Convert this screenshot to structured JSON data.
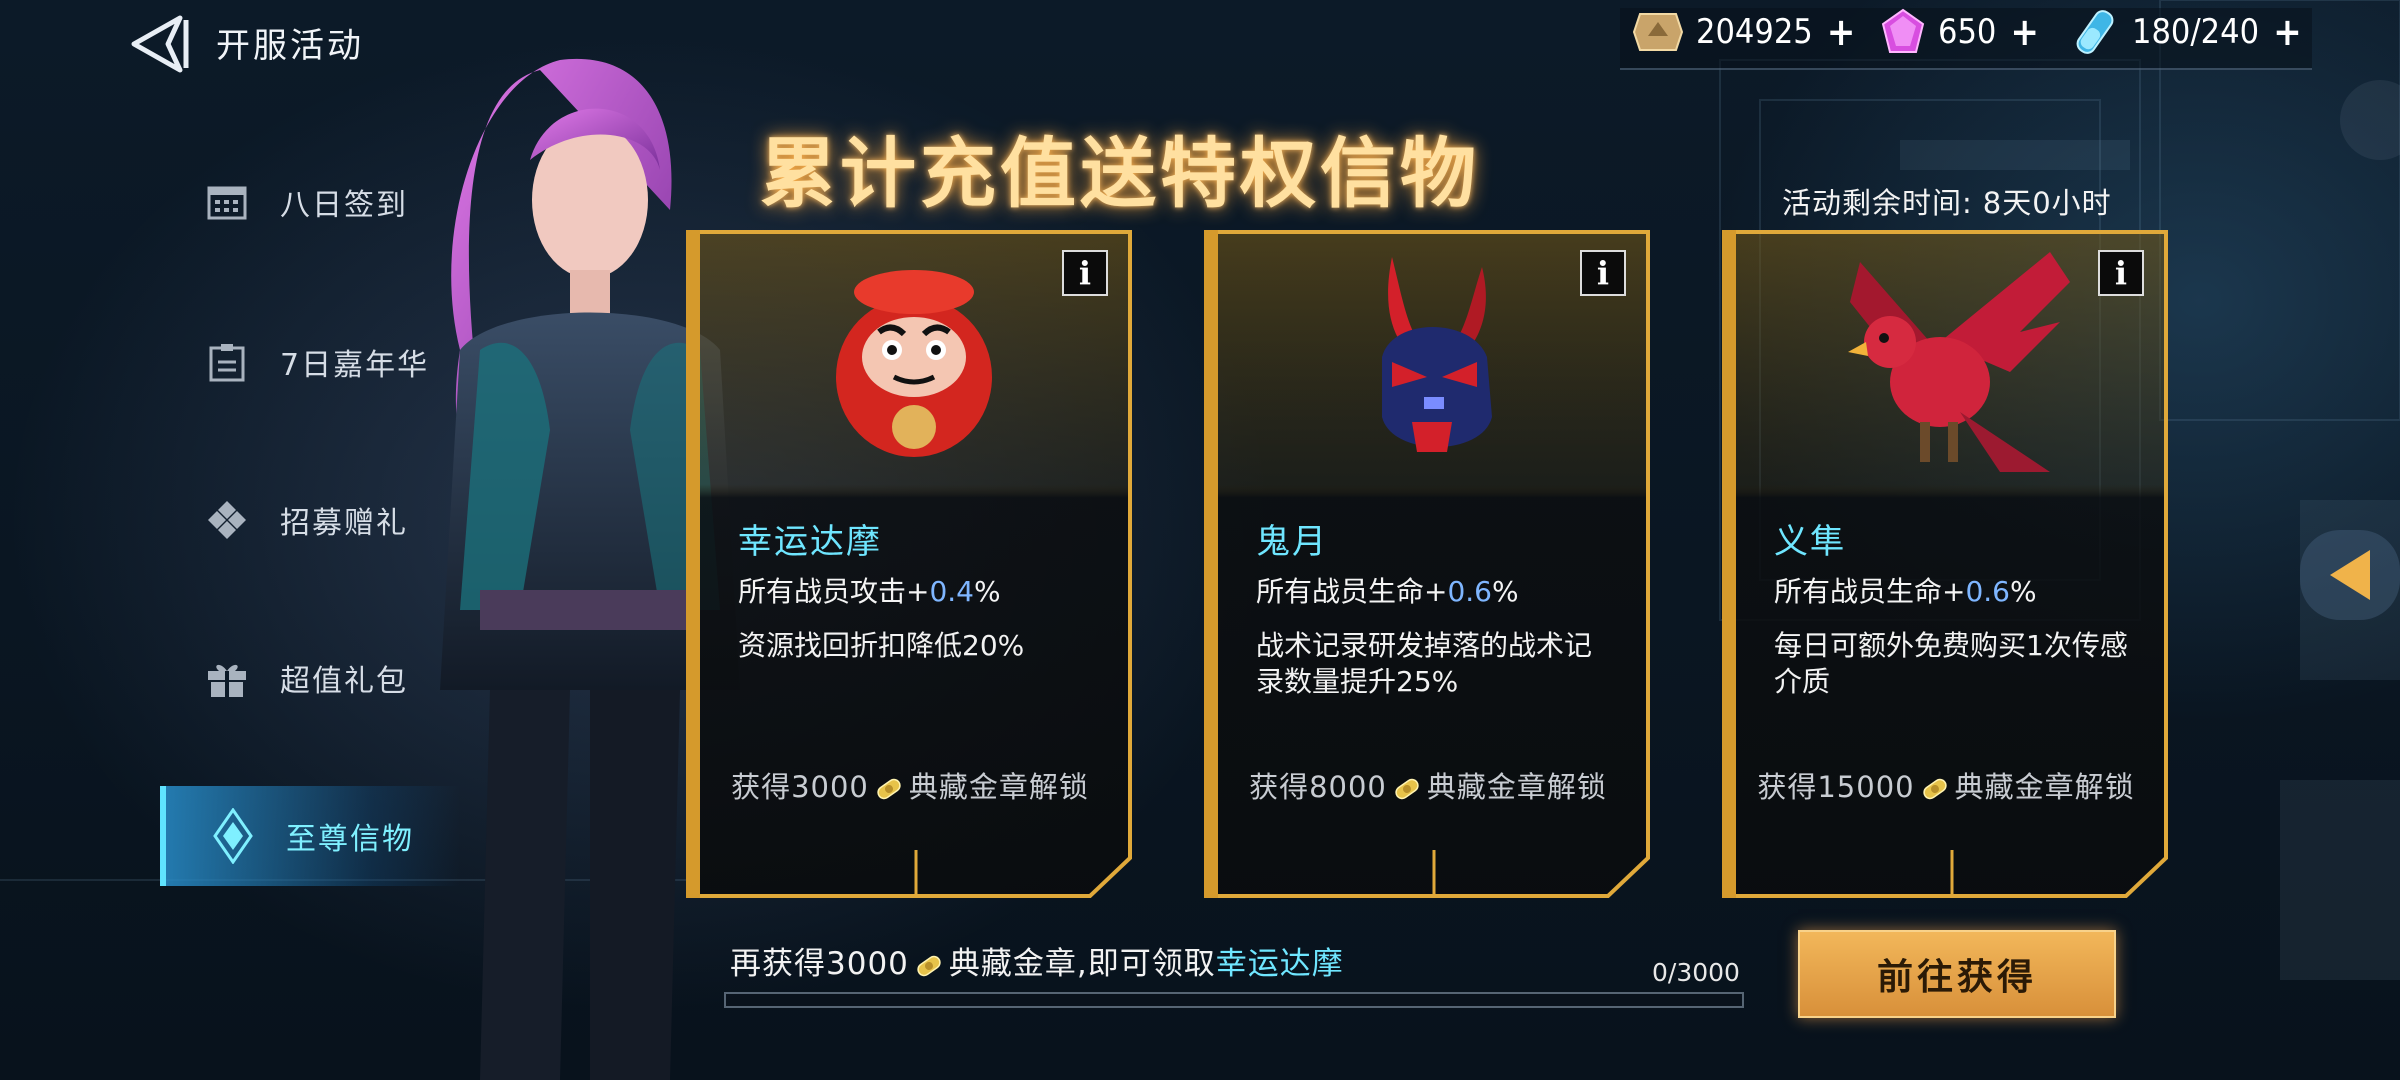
{
  "header": {
    "title": "开服活动"
  },
  "resources": [
    {
      "icon": "gold-medal-icon",
      "value": "204925",
      "plus": "+"
    },
    {
      "icon": "purple-crystal-icon",
      "value": "650",
      "plus": "+"
    },
    {
      "icon": "stamina-vial-icon",
      "value": "180/240",
      "plus": "+"
    }
  ],
  "sidebar": {
    "items": [
      {
        "label": "八日签到",
        "icon": "calendar-icon",
        "active": false
      },
      {
        "label": "7日嘉年华",
        "icon": "clipboard-icon",
        "active": false
      },
      {
        "label": "招募赠礼",
        "icon": "diamond-cluster-icon",
        "active": false
      },
      {
        "label": "超值礼包",
        "icon": "gift-box-icon",
        "active": false
      },
      {
        "label": "至尊信物",
        "icon": "crystal-emblem-icon",
        "active": true
      }
    ]
  },
  "event": {
    "headline": "累计充值送特权信物",
    "timer_label": "活动剩余时间:",
    "timer_value": "8天0小时"
  },
  "cards": [
    {
      "name": "幸运达摩",
      "attr_prefix": "所有战员攻击+",
      "attr_value": "0.4",
      "attr_suffix": "%",
      "desc": "资源找回折扣降低20%",
      "req_prefix": "获得3000",
      "req_suffix": "典藏金章解锁",
      "image": "daruma-doll"
    },
    {
      "name": "鬼月",
      "attr_prefix": "所有战员生命+",
      "attr_value": "0.6",
      "attr_suffix": "%",
      "desc": "战术记录研发掉落的战术记录数量提升25%",
      "req_prefix": "获得8000",
      "req_suffix": "典藏金章解锁",
      "image": "oni-mask"
    },
    {
      "name": "义隼",
      "attr_prefix": "所有战员生命+",
      "attr_value": "0.6",
      "attr_suffix": "%",
      "desc": "每日可额外免费购买1次传感介质",
      "req_prefix": "获得15000",
      "req_suffix": "典藏金章解锁",
      "image": "mech-falcon"
    }
  ],
  "progress": {
    "text_prefix": "再获得3000",
    "text_middle": "典藏金章,即可领取",
    "text_highlight": "幸运达摩",
    "count": "0/3000",
    "fraction": 0
  },
  "action": {
    "go_label": "前往获得"
  },
  "colors": {
    "accent_gold": "#f0b34a",
    "accent_cyan": "#6fe6ff",
    "percent_blue": "#7fb6ff"
  }
}
